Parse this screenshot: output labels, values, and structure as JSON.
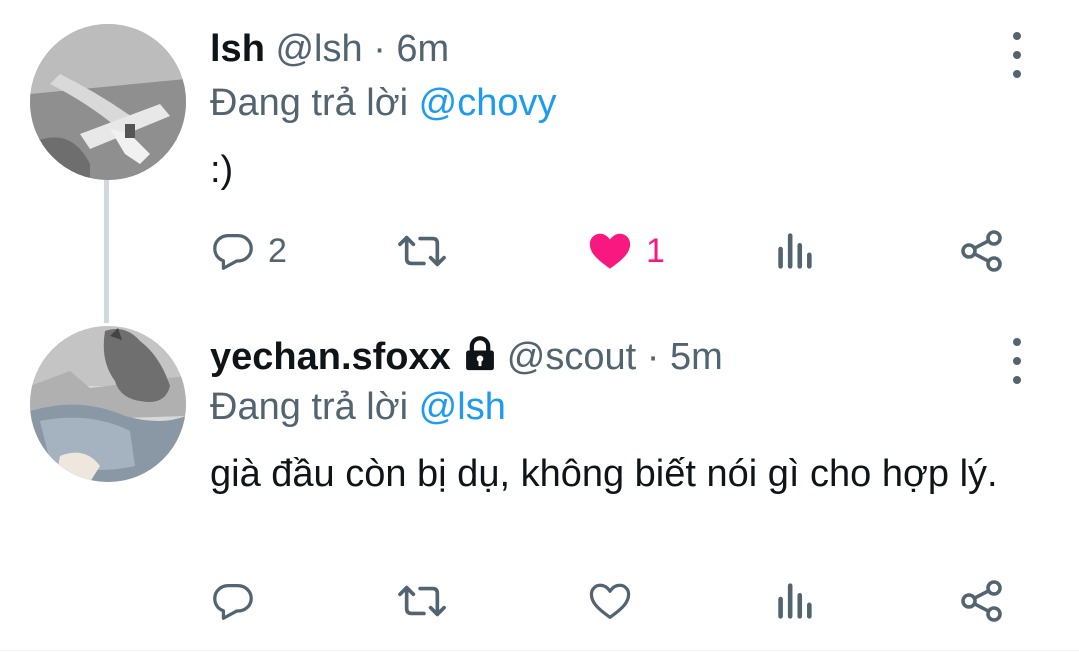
{
  "tweets": [
    {
      "display_name": "lsh",
      "handle": "@lsh",
      "separator": "·",
      "time": "6m",
      "reply_prefix": "Đang trả lời",
      "reply_mention": "@chovy",
      "text": ":)",
      "replies": "2",
      "likes": "1",
      "liked": true,
      "protected": false
    },
    {
      "display_name": "yechan.sfoxx",
      "handle": "@scout",
      "separator": "·",
      "time": "5m",
      "reply_prefix": "Đang trả lời",
      "reply_mention": "@lsh",
      "text": "già đầu còn bị dụ, không biết nói gì cho hợp lý.",
      "replies": "",
      "likes": "",
      "liked": false,
      "protected": true
    }
  ],
  "colors": {
    "accent": "#1d9bf0",
    "like": "#f91880",
    "secondary_text": "#536471",
    "primary_text": "#0f1419"
  },
  "icons": [
    "reply-icon",
    "retweet-icon",
    "like-icon",
    "views-icon",
    "share-icon",
    "more-icon",
    "lock-icon"
  ]
}
